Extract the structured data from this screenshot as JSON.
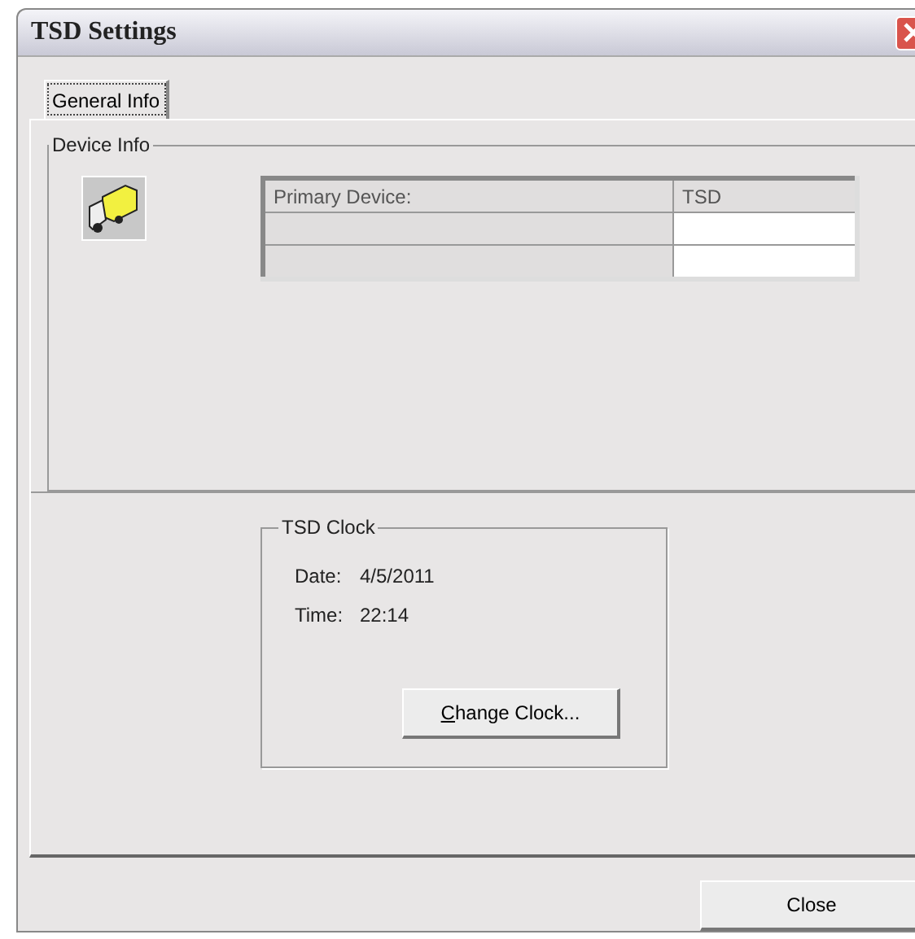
{
  "window": {
    "title": "TSD Settings"
  },
  "tabs": [
    {
      "label": "General Info",
      "selected": true
    }
  ],
  "device_info": {
    "title": "Device Info",
    "table": {
      "rows": [
        [
          "Primary Device:",
          "TSD"
        ],
        [
          "",
          ""
        ],
        [
          "",
          ""
        ]
      ]
    }
  },
  "clock": {
    "title": "TSD Clock",
    "fields": [
      {
        "label": "Date:",
        "value": "4/5/2011"
      },
      {
        "label": "Time:",
        "value": "22:14"
      }
    ],
    "button": "Change Clock..."
  },
  "buttons": [
    "Close"
  ]
}
